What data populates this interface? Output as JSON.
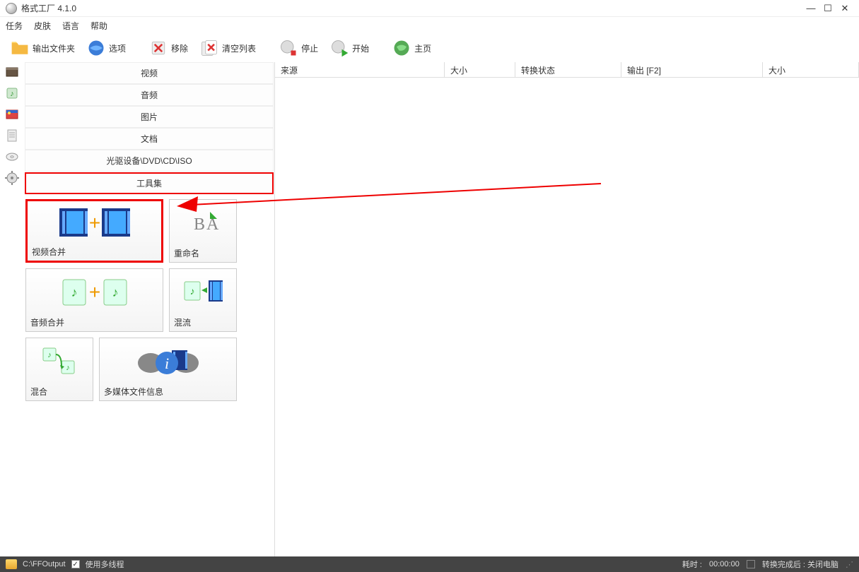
{
  "app": {
    "title": "格式工厂 4.1.0"
  },
  "menu": {
    "task": "任务",
    "skin": "皮肤",
    "language": "语言",
    "help": "帮助"
  },
  "toolbar": {
    "output_folder": "输出文件夹",
    "options": "选项",
    "remove": "移除",
    "clear_list": "清空列表",
    "stop": "停止",
    "start": "开始",
    "home": "主页"
  },
  "categories": {
    "video": "视频",
    "audio": "音频",
    "picture": "图片",
    "document": "文档",
    "optical": "光驱设备\\DVD\\CD\\ISO",
    "toolset": "工具集"
  },
  "tools": {
    "video_merge": "视频合并",
    "rename": "重命名",
    "audio_merge": "音频合并",
    "mux": "混流",
    "mix": "混合",
    "media_info": "多媒体文件信息"
  },
  "table": {
    "source": "来源",
    "size": "大小",
    "status": "转换状态",
    "output": "输出 [F2]",
    "size2": "大小"
  },
  "status": {
    "output_path": "C:\\FFOutput",
    "multithread": "使用多线程",
    "elapsed_label": "耗时 :",
    "elapsed_time": "00:00:00",
    "after_convert": "转换完成后 : 关闭电脑"
  }
}
